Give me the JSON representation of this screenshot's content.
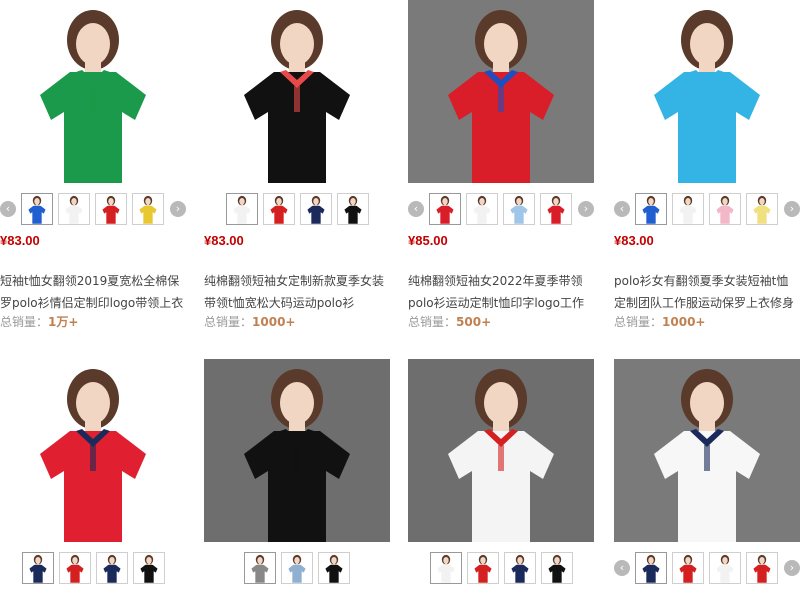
{
  "products": [
    {
      "price": "¥83.00",
      "title_lines": [
        "短袖t恤女翻领2019夏宽松全棉保",
        "罗polo衫情侣定制印logo带领上衣"
      ],
      "sales_label": "总销量：",
      "sales_value": "1万+",
      "shirt_color": "#1a9a4a",
      "collar_color": "#1a9a4a",
      "bg_color": "#ffffff",
      "thumbs": [
        "#1f5fd0",
        "#f2f2f2",
        "#d42020",
        "#e8c830"
      ],
      "has_arrows": true
    },
    {
      "price": "¥83.00",
      "title_lines": [
        "纯棉翻领短袖女定制新款夏季女装",
        "带领t恤宽松大码运动polo衫"
      ],
      "sales_label": "总销量：",
      "sales_value": "1000+",
      "shirt_color": "#111111",
      "collar_color": "#e84a4a",
      "bg_color": "#ffffff",
      "thumbs": [
        "#f2f2f2",
        "#d42020",
        "#1a2a5a",
        "#111111"
      ],
      "has_arrows": false
    },
    {
      "price": "¥85.00",
      "title_lines": [
        "纯棉翻领短袖女2022年夏季带领",
        "polo衫运动定制t恤印字logo工作"
      ],
      "sales_label": "总销量：",
      "sales_value": "500+",
      "shirt_color": "#d91e2a",
      "collar_color": "#1d4fc2",
      "bg_color": "#7a7a7a",
      "thumbs": [
        "#d91e2a",
        "#f2f2f2",
        "#9fc6e8",
        "#d91e2a"
      ],
      "has_arrows": true
    },
    {
      "price": "¥83.00",
      "title_lines": [
        "polo衫女有翻领夏季女装短袖t恤",
        "定制团队工作服运动保罗上衣修身"
      ],
      "sales_label": "总销量：",
      "sales_value": "1000+",
      "shirt_color": "#34b4e4",
      "collar_color": "#34b4e4",
      "bg_color": "#ffffff",
      "thumbs": [
        "#1f5fd0",
        "#f2f2f2",
        "#f2b8c8",
        "#f0e080"
      ],
      "has_arrows": true
    },
    {
      "shirt_color": "#e02030",
      "collar_color": "#1a2a5a",
      "bg_color": "#ffffff",
      "thumbs": [
        "#1a2a5a",
        "#d42020",
        "#1a2a5a",
        "#111111"
      ],
      "has_arrows": false
    },
    {
      "shirt_color": "#111111",
      "collar_color": "#111111",
      "bg_color": "#6e6e6e",
      "thumbs": [
        "#888888",
        "#8fb0d0",
        "#111111"
      ],
      "has_arrows": false
    },
    {
      "shirt_color": "#f4f4f4",
      "collar_color": "#d42020",
      "bg_color": "#6e6e6e",
      "thumbs": [
        "#f2f2f2",
        "#d42020",
        "#1a2a5a",
        "#111111"
      ],
      "has_arrows": false
    },
    {
      "shirt_color": "#f7f7f7",
      "collar_color": "#1a2a5a",
      "bg_color": "#7a7a7a",
      "thumbs": [
        "#1a2a5a",
        "#d42020",
        "#f2f2f2",
        "#d42020"
      ],
      "has_arrows": true
    }
  ],
  "icons": {
    "prev": "chevron-left-icon",
    "next": "chevron-right-icon"
  },
  "arrow_glyphs": {
    "prev": "‹",
    "next": "›"
  }
}
